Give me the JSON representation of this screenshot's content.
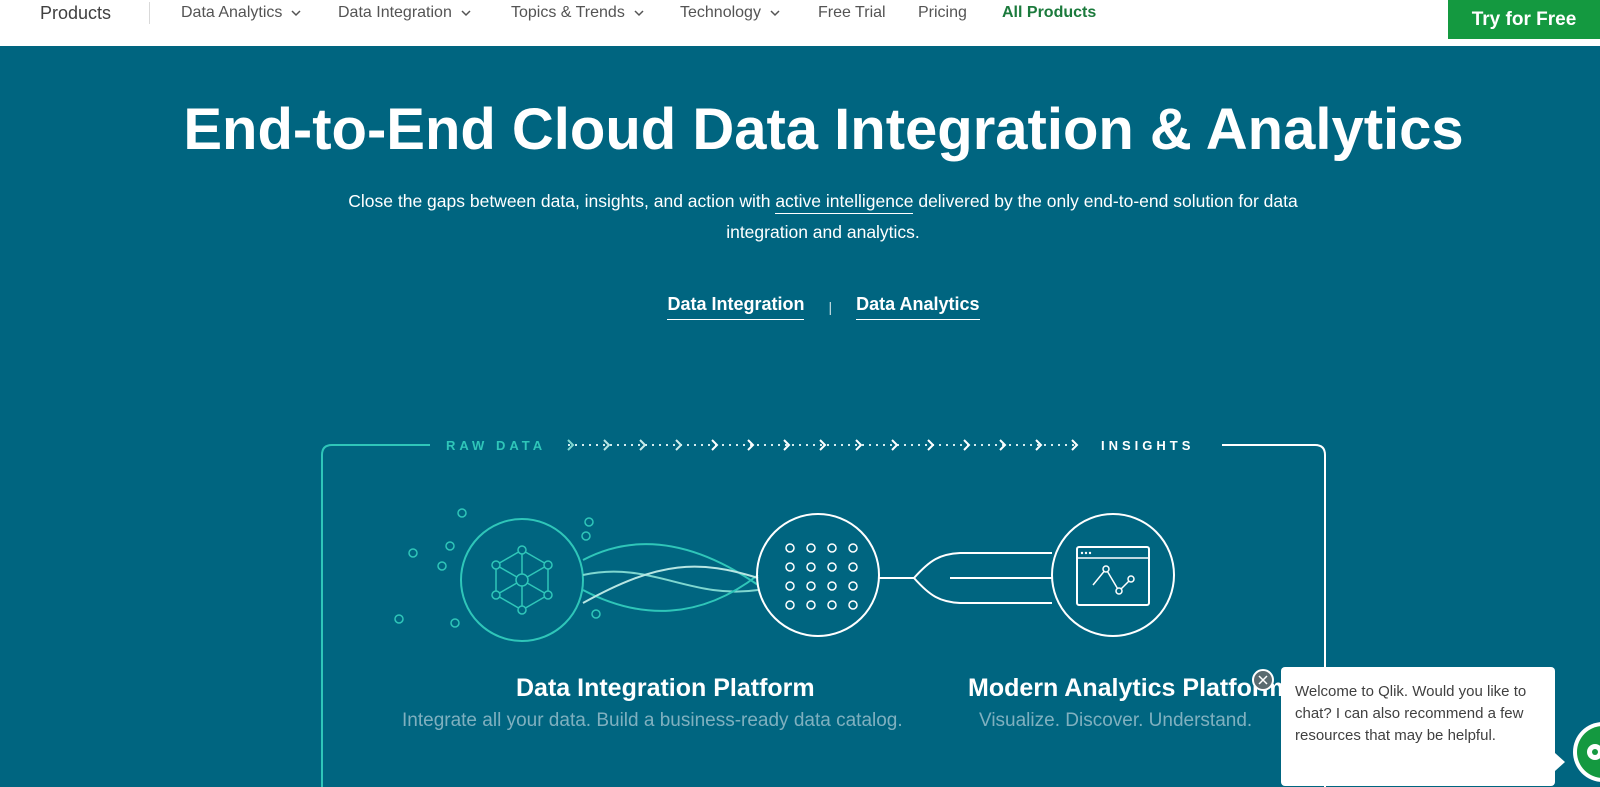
{
  "nav": {
    "products": "Products",
    "items": [
      {
        "label": "Data Analytics",
        "has_dropdown": true
      },
      {
        "label": "Data Integration",
        "has_dropdown": true
      },
      {
        "label": "Topics & Trends",
        "has_dropdown": true
      },
      {
        "label": "Technology",
        "has_dropdown": true
      },
      {
        "label": "Free Trial",
        "has_dropdown": false
      },
      {
        "label": "Pricing",
        "has_dropdown": false
      },
      {
        "label": "All Products",
        "has_dropdown": false,
        "active": true
      }
    ],
    "cta": "Try for Free"
  },
  "hero": {
    "title": "End-to-End Cloud Data Integration & Analytics",
    "subtitle_before": "Close the gaps between data, insights, and action with ",
    "subtitle_link": "active intelligence",
    "subtitle_after": " delivered by the only end-to-end solution for data integration and analytics.",
    "tabs": [
      "Data Integration",
      "Data Analytics"
    ],
    "separator": "|"
  },
  "diagram": {
    "raw_label": "RAW DATA",
    "insights_label": "INSIGHTS",
    "platforms": [
      {
        "title": "Data Integration Platform",
        "subtitle": "Integrate all your data. Build a business-ready data catalog."
      },
      {
        "title": "Modern Analytics Platform",
        "subtitle": "Visualize. Discover. Understand."
      }
    ]
  },
  "chat": {
    "message": "Welcome to Qlik. Would you like to chat? I can also recommend a few resources that may be helpful.",
    "close_icon": "close-icon"
  },
  "colors": {
    "hero_bg": "#006580",
    "accent_green": "#149940",
    "teal_line": "#2fc6b9",
    "active_nav": "#1b7a3c"
  }
}
